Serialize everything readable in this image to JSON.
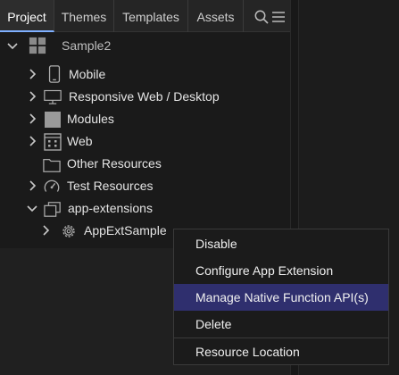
{
  "tabs": [
    "Project",
    "Themes",
    "Templates",
    "Assets"
  ],
  "project": {
    "name": "Sample2",
    "items": [
      {
        "label": "Mobile",
        "icon": "mobile-icon",
        "expandable": true
      },
      {
        "label": "Responsive Web / Desktop",
        "icon": "monitor-icon",
        "expandable": true
      },
      {
        "label": "Modules",
        "icon": "module-icon",
        "expandable": true
      },
      {
        "label": "Web",
        "icon": "web-grid-icon",
        "expandable": true
      },
      {
        "label": "Other Resources",
        "icon": "folder-icon",
        "expandable": false
      },
      {
        "label": "Test Resources",
        "icon": "speedometer-icon",
        "expandable": true
      },
      {
        "label": "app-extensions",
        "icon": "extension-icon",
        "expandable": true,
        "expanded": true
      },
      {
        "label": "AppExtSample",
        "icon": "gear-icon",
        "expandable": true
      }
    ]
  },
  "context_menu": {
    "items": [
      "Disable",
      "Configure App Extension",
      "Manage Native Function API(s)",
      "Delete",
      "Resource Location"
    ],
    "highlighted": "Manage Native Function API(s)"
  },
  "colors": {
    "active_tab_underline": "#7fb0ff",
    "menu_highlight": "#2f2f6e"
  }
}
